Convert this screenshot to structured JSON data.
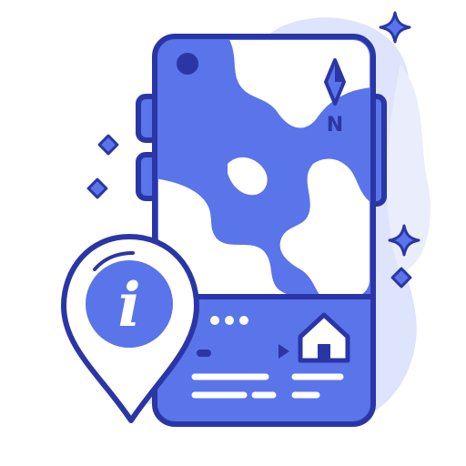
{
  "colors": {
    "outline": "#2a36a6",
    "primary_fill": "#5a74ea",
    "light_blob": "#dde4fb",
    "lighter_blob": "#e9edfc",
    "white": "#ffffff"
  },
  "icons": [
    "smartphone-icon",
    "compass-north-icon",
    "home-icon",
    "play-arrow-icon",
    "more-dots-icon",
    "info-location-pin-icon",
    "sparkle-icon",
    "diamond-icon"
  ],
  "compass": {
    "letter": "N"
  },
  "info_pin": {
    "glyph": "i"
  }
}
